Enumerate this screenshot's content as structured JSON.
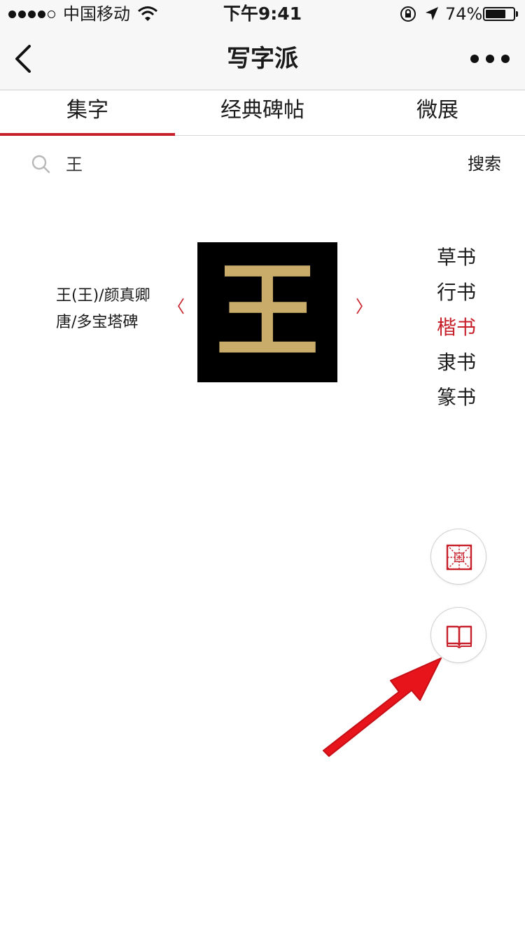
{
  "status_bar": {
    "carrier": "中国移动",
    "time": "下午9:41",
    "battery_percent": "74%",
    "battery_level": 0.74,
    "icons": [
      "signal-dots",
      "wifi-icon",
      "orientation-lock-icon",
      "location-arrow-icon",
      "battery-icon"
    ]
  },
  "nav": {
    "title": "写字派",
    "back_icon": "chevron-left-icon",
    "more_icon": "ellipsis-icon"
  },
  "tabs": [
    {
      "label": "集字",
      "active": true
    },
    {
      "label": "经典碑帖",
      "active": false
    },
    {
      "label": "微展",
      "active": false
    }
  ],
  "search": {
    "value": "王",
    "button_label": "搜索",
    "icon": "search-icon"
  },
  "character": {
    "glyph": "王",
    "info_line1": "王(王)/颜真卿",
    "info_line2": "唐/多宝塔碑",
    "prev_arrow": "〈",
    "next_arrow": "〉"
  },
  "styles": [
    {
      "label": "草书",
      "active": false
    },
    {
      "label": "行书",
      "active": false
    },
    {
      "label": "楷书",
      "active": true
    },
    {
      "label": "隶书",
      "active": false
    },
    {
      "label": "篆书",
      "active": false
    }
  ],
  "fabs": [
    {
      "icon": "calligraphy-grid-icon"
    },
    {
      "icon": "book-icon"
    }
  ],
  "colors": {
    "accent": "#c8202a",
    "glyph_gold": "#c9ab6a",
    "annotation_arrow": "#e8141c"
  }
}
